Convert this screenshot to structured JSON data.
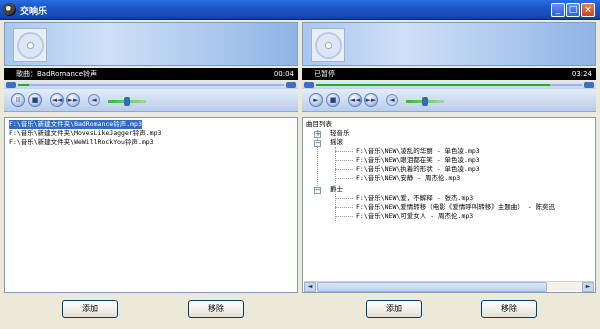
{
  "window": {
    "title": "交响乐",
    "min_label": "_",
    "max_label": "□",
    "close_label": "×"
  },
  "players": [
    {
      "song_prefix": "歌曲：",
      "song": "BadRomance铃声",
      "time": "00:04",
      "progress": 0.04,
      "controls": {
        "play_pause": "II",
        "stop": "■",
        "prev": "◄◄",
        "next": "►►",
        "volume": "◄"
      }
    },
    {
      "status": "已暂停",
      "time": "03:24",
      "progress": 0.88,
      "controls": {
        "play_pause": "►",
        "stop": "■",
        "prev": "◄◄",
        "next": "►►",
        "volume": "◄"
      }
    }
  ],
  "playlist": {
    "items": [
      "F:\\音乐\\新建文件夹\\BadRomance铃声.mp3",
      "F:\\音乐\\新建文件夹\\MovesLikeJagger铃声.mp3",
      "F:\\音乐\\新建文件夹\\WeWillRockYou铃声.mp3"
    ],
    "selected_index": 0
  },
  "tree": {
    "root": "曲目列表",
    "categories": [
      {
        "name": "轻音乐",
        "expanded": false,
        "box": "+",
        "songs": []
      },
      {
        "name": "摇滚",
        "expanded": true,
        "box": "−",
        "songs": [
          "F:\\音乐\\NEW\\凌乱的华丽 - 单色凌.mp3",
          "F:\\音乐\\NEW\\眼泪都在笑 - 单色凌.mp3",
          "F:\\音乐\\NEW\\执着的形状 - 单色凌.mp3",
          "F:\\音乐\\NEW\\安静 - 周杰伦.mp3"
        ]
      },
      {
        "name": "爵士",
        "expanded": true,
        "box": "−",
        "songs": [
          "F:\\音乐\\NEW\\爱，不解释 - 张杰.mp3",
          "F:\\音乐\\NEW\\爱情转移（电影《爱情呼叫转移》主题曲） - 陈奕迅",
          "F:\\音乐\\NEW\\可爱女人 - 周杰伦.mp3"
        ]
      }
    ]
  },
  "buttons": {
    "add": "添加",
    "remove": "移除"
  },
  "colors": {
    "titlebar": "#1a55c9",
    "selection": "#316ac5",
    "progress": "#1bb41b"
  }
}
